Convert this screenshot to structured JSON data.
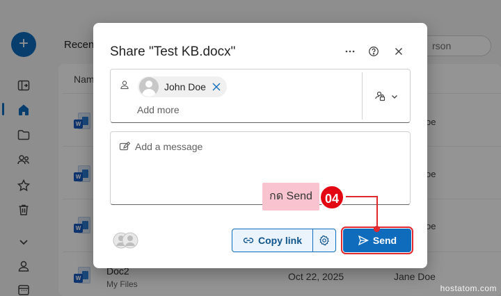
{
  "app": {
    "recent_heading": "Recen",
    "search_placeholder": "rson",
    "column_name": "Nam",
    "rows": [
      {
        "right": "oe"
      },
      {
        "right": "oe"
      },
      {
        "right": "oe"
      },
      {
        "name": "Doc2",
        "location": "My Files",
        "date": "Oct 22, 2025",
        "owner": "Jane Doe"
      }
    ]
  },
  "dialog": {
    "title": "Share \"Test KB.docx\"",
    "recipient": {
      "name": "John Doe"
    },
    "add_more_label": "Add more",
    "message_placeholder": "Add a message",
    "copy_link_label": "Copy link",
    "send_label": "Send"
  },
  "annotation": {
    "label": "กด Send",
    "step": "04"
  },
  "watermark": "hostatom.com",
  "colors": {
    "accent": "#0f6cbd",
    "annotation_red": "#e30613",
    "annotation_pink": "#f9c4cf"
  },
  "icons": [
    "plus-icon",
    "panel-icon",
    "home-icon",
    "folder-icon",
    "people-icon",
    "star-icon",
    "trash-icon",
    "chevron-down-icon",
    "person-icon",
    "calendar-icon",
    "more-icon",
    "help-icon",
    "close-icon",
    "link-icon",
    "gear-icon",
    "send-icon",
    "edit-icon"
  ]
}
